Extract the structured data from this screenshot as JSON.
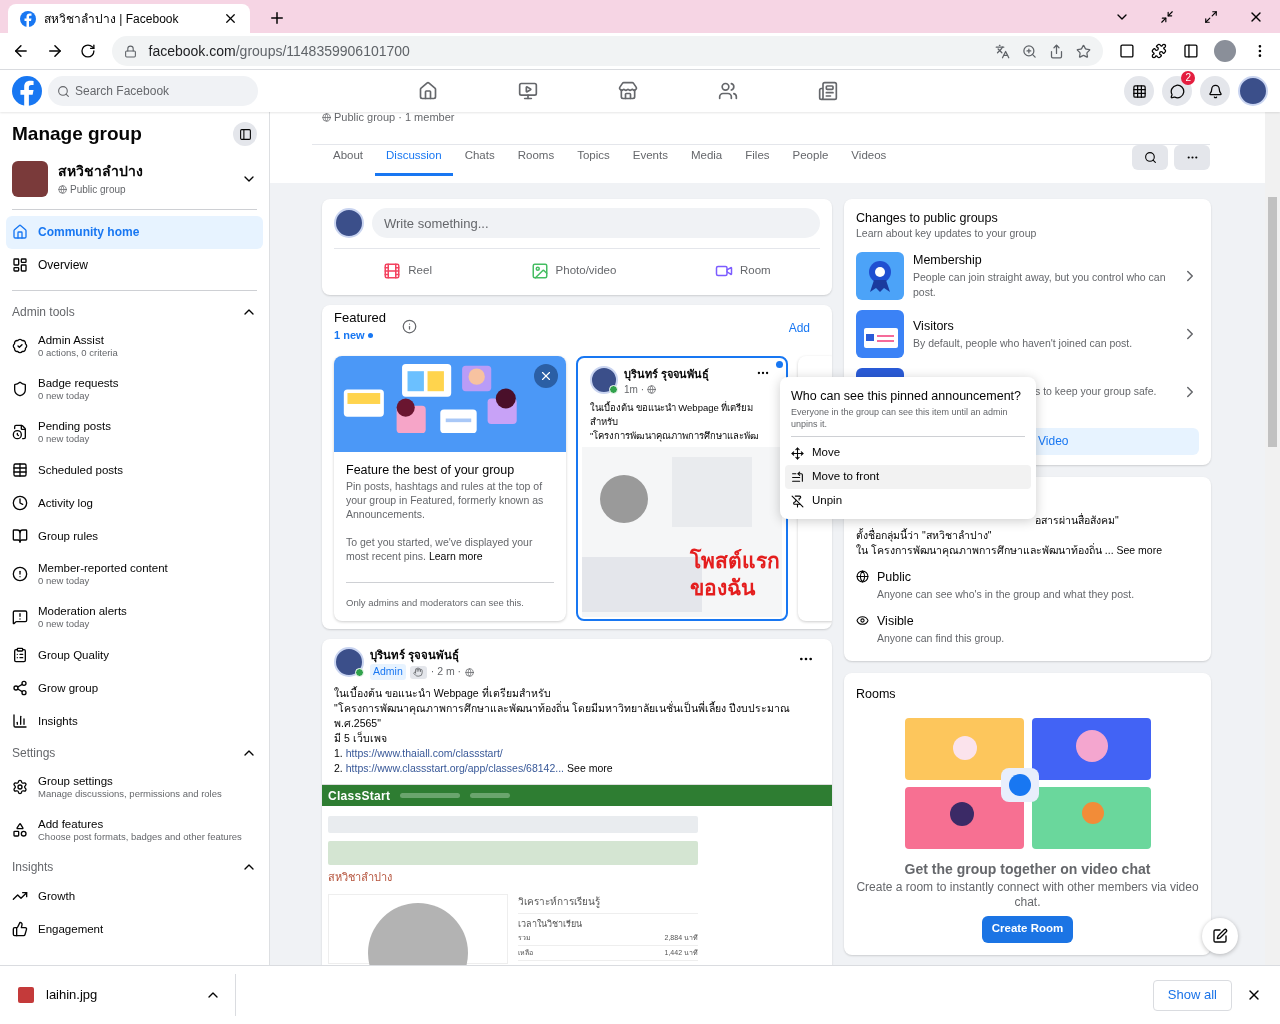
{
  "browser": {
    "tab_title": "สหวิชาลำปาง | Facebook",
    "url_domain": "facebook.com",
    "url_path": "/groups/1148359906101700"
  },
  "header": {
    "search_placeholder": "Search Facebook",
    "messenger_badge": "2"
  },
  "sidebar": {
    "title": "Manage group",
    "group_name": "สหวิชาลำปาง",
    "group_privacy": "Public group",
    "primary": [
      {
        "label": "Community home",
        "selected": true
      },
      {
        "label": "Overview",
        "selected": false
      }
    ],
    "sections": [
      {
        "title": "Admin tools",
        "expanded": true,
        "items": [
          {
            "label": "Admin Assist",
            "sub": "0 actions, 0 criteria"
          },
          {
            "label": "Badge requests",
            "sub": "0 new today"
          },
          {
            "label": "Pending posts",
            "sub": "0 new today"
          },
          {
            "label": "Scheduled posts"
          },
          {
            "label": "Activity log"
          },
          {
            "label": "Group rules"
          },
          {
            "label": "Member-reported content",
            "sub": "0 new today"
          },
          {
            "label": "Moderation alerts",
            "sub": "0 new today"
          },
          {
            "label": "Group Quality"
          },
          {
            "label": "Grow group"
          },
          {
            "label": "Insights"
          }
        ]
      },
      {
        "title": "Settings",
        "expanded": true,
        "items": [
          {
            "label": "Group settings",
            "sub": "Manage discussions, permissions and roles"
          },
          {
            "label": "Add features",
            "sub": "Choose post formats, badges and other features"
          }
        ]
      },
      {
        "title": "Insights",
        "expanded": true,
        "items": [
          {
            "label": "Growth"
          },
          {
            "label": "Engagement"
          }
        ]
      }
    ]
  },
  "group_meta": "Public group · 1 member",
  "tabs": [
    {
      "label": "About",
      "selected": false
    },
    {
      "label": "Discussion",
      "selected": true
    },
    {
      "label": "Chats",
      "selected": false
    },
    {
      "label": "Rooms",
      "selected": false
    },
    {
      "label": "Topics",
      "selected": false
    },
    {
      "label": "Events",
      "selected": false
    },
    {
      "label": "Media",
      "selected": false
    },
    {
      "label": "Files",
      "selected": false
    },
    {
      "label": "People",
      "selected": false
    },
    {
      "label": "Videos",
      "selected": false
    }
  ],
  "composer": {
    "placeholder": "Write something...",
    "actions": [
      "Reel",
      "Photo/video",
      "Room"
    ]
  },
  "featured": {
    "title": "Featured",
    "new_count": "1 new",
    "add": "Add",
    "intro": {
      "title": "Feature the best of your group",
      "body": "Pin posts, hashtags and rules at the top of your group in Featured, formerly known as Announcements.",
      "body2": "To get you started, we've displayed your most recent pins.",
      "link": "Learn more",
      "footer": "Only admins and moderators can see this."
    },
    "pinned": {
      "author": "บุรินทร์ รุจจนพันธุ์",
      "time": "1m ·",
      "unread": true,
      "lines": [
        "ในเบื้องต้น ขอแนะนำ Webpage ที่เตรียม",
        "สำหรับ",
        "\"โครงการพัฒนาคุณภาพการศึกษาและพัฒ"
      ],
      "overlay": [
        "โพสต์แรก",
        "ของฉัน"
      ]
    }
  },
  "menu": {
    "title": "Who can see this pinned announcement?",
    "note": "Everyone in the group can see this item until an admin unpins it.",
    "items": [
      {
        "label": "Move",
        "selected": false
      },
      {
        "label": "Move to front",
        "selected": true
      },
      {
        "label": "Unpin",
        "selected": false
      }
    ]
  },
  "post": {
    "author": "บุรินทร์ รุจจนพันธุ์",
    "badge": "Admin",
    "time": "· 2 m ·",
    "lines": [
      "ในเบื้องต้น ขอแนะนำ Webpage ที่เตรียมสำหรับ",
      "\"โครงการพัฒนาคุณภาพการศึกษาและพัฒนาท้องถิ่น โดยมีมหาวิทยาลัยเนชั่นเป็นพี่เลี้ยง ปีงบประมาณ พ.ศ.2565\"",
      "มี 5 เว็บเพจ"
    ],
    "links": [
      {
        "number": "1.",
        "url": "https://www.thaiall.com/classstart/"
      },
      {
        "number": "2.",
        "url": "https://www.classstart.org/app/classes/68142..."
      }
    ],
    "see_more": "See more",
    "image": {
      "brand": "ClassStart",
      "class_name": "สหวิชาลำปาง",
      "panel_title": "วิเคราะห์การเรียนรู้",
      "panel_sub": "เวลาในวิชาเรียน",
      "rows": [
        {
          "label": "รวม",
          "value": "2,884 นาที"
        },
        {
          "label": "เหลือ",
          "value": "1,442 นาที"
        }
      ]
    }
  },
  "changes": {
    "title": "Changes to public groups",
    "subtitle": "Learn about key updates to your group",
    "items": [
      {
        "title": "Membership",
        "text": "People can join straight away, but you control who can post."
      },
      {
        "title": "Visitors",
        "text": "By default, people who haven't joined can post."
      },
      {
        "text": "s to keep your group safe."
      }
    ],
    "button": "Video"
  },
  "about": {
    "lines": [
      "อสารผ่านสื่อสังคม\"",
      "ตั้งชื่อกลุ่มนี้ว่า \"สหวิชาลำปาง\""
    ],
    "last_line": "ใน โครงการพัฒนาคุณภาพการศึกษาและพัฒนาท้องถิ่น ...",
    "see_more": "See more",
    "facts": [
      {
        "title": "Public",
        "text": "Anyone can see who's in the group and what they post."
      },
      {
        "title": "Visible",
        "text": "Anyone can find this group."
      }
    ]
  },
  "rooms": {
    "title": "Rooms",
    "heading": "Get the group together on video chat",
    "text": "Create a room to instantly connect with other members via video chat.",
    "button": "Create Room"
  },
  "downloads": {
    "file": "laihin.jpg",
    "show_all": "Show all"
  }
}
